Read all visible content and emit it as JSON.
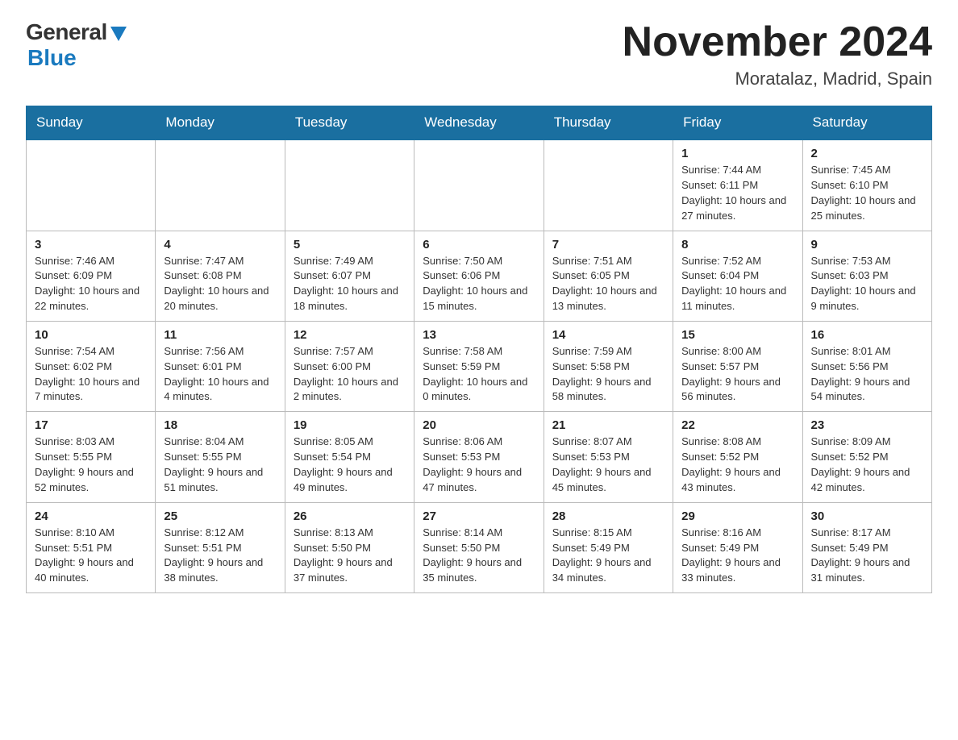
{
  "logo": {
    "general": "General",
    "blue": "Blue"
  },
  "title": "November 2024",
  "location": "Moratalaz, Madrid, Spain",
  "days_of_week": [
    "Sunday",
    "Monday",
    "Tuesday",
    "Wednesday",
    "Thursday",
    "Friday",
    "Saturday"
  ],
  "weeks": [
    [
      {
        "day": "",
        "info": ""
      },
      {
        "day": "",
        "info": ""
      },
      {
        "day": "",
        "info": ""
      },
      {
        "day": "",
        "info": ""
      },
      {
        "day": "",
        "info": ""
      },
      {
        "day": "1",
        "info": "Sunrise: 7:44 AM\nSunset: 6:11 PM\nDaylight: 10 hours and 27 minutes."
      },
      {
        "day": "2",
        "info": "Sunrise: 7:45 AM\nSunset: 6:10 PM\nDaylight: 10 hours and 25 minutes."
      }
    ],
    [
      {
        "day": "3",
        "info": "Sunrise: 7:46 AM\nSunset: 6:09 PM\nDaylight: 10 hours and 22 minutes."
      },
      {
        "day": "4",
        "info": "Sunrise: 7:47 AM\nSunset: 6:08 PM\nDaylight: 10 hours and 20 minutes."
      },
      {
        "day": "5",
        "info": "Sunrise: 7:49 AM\nSunset: 6:07 PM\nDaylight: 10 hours and 18 minutes."
      },
      {
        "day": "6",
        "info": "Sunrise: 7:50 AM\nSunset: 6:06 PM\nDaylight: 10 hours and 15 minutes."
      },
      {
        "day": "7",
        "info": "Sunrise: 7:51 AM\nSunset: 6:05 PM\nDaylight: 10 hours and 13 minutes."
      },
      {
        "day": "8",
        "info": "Sunrise: 7:52 AM\nSunset: 6:04 PM\nDaylight: 10 hours and 11 minutes."
      },
      {
        "day": "9",
        "info": "Sunrise: 7:53 AM\nSunset: 6:03 PM\nDaylight: 10 hours and 9 minutes."
      }
    ],
    [
      {
        "day": "10",
        "info": "Sunrise: 7:54 AM\nSunset: 6:02 PM\nDaylight: 10 hours and 7 minutes."
      },
      {
        "day": "11",
        "info": "Sunrise: 7:56 AM\nSunset: 6:01 PM\nDaylight: 10 hours and 4 minutes."
      },
      {
        "day": "12",
        "info": "Sunrise: 7:57 AM\nSunset: 6:00 PM\nDaylight: 10 hours and 2 minutes."
      },
      {
        "day": "13",
        "info": "Sunrise: 7:58 AM\nSunset: 5:59 PM\nDaylight: 10 hours and 0 minutes."
      },
      {
        "day": "14",
        "info": "Sunrise: 7:59 AM\nSunset: 5:58 PM\nDaylight: 9 hours and 58 minutes."
      },
      {
        "day": "15",
        "info": "Sunrise: 8:00 AM\nSunset: 5:57 PM\nDaylight: 9 hours and 56 minutes."
      },
      {
        "day": "16",
        "info": "Sunrise: 8:01 AM\nSunset: 5:56 PM\nDaylight: 9 hours and 54 minutes."
      }
    ],
    [
      {
        "day": "17",
        "info": "Sunrise: 8:03 AM\nSunset: 5:55 PM\nDaylight: 9 hours and 52 minutes."
      },
      {
        "day": "18",
        "info": "Sunrise: 8:04 AM\nSunset: 5:55 PM\nDaylight: 9 hours and 51 minutes."
      },
      {
        "day": "19",
        "info": "Sunrise: 8:05 AM\nSunset: 5:54 PM\nDaylight: 9 hours and 49 minutes."
      },
      {
        "day": "20",
        "info": "Sunrise: 8:06 AM\nSunset: 5:53 PM\nDaylight: 9 hours and 47 minutes."
      },
      {
        "day": "21",
        "info": "Sunrise: 8:07 AM\nSunset: 5:53 PM\nDaylight: 9 hours and 45 minutes."
      },
      {
        "day": "22",
        "info": "Sunrise: 8:08 AM\nSunset: 5:52 PM\nDaylight: 9 hours and 43 minutes."
      },
      {
        "day": "23",
        "info": "Sunrise: 8:09 AM\nSunset: 5:52 PM\nDaylight: 9 hours and 42 minutes."
      }
    ],
    [
      {
        "day": "24",
        "info": "Sunrise: 8:10 AM\nSunset: 5:51 PM\nDaylight: 9 hours and 40 minutes."
      },
      {
        "day": "25",
        "info": "Sunrise: 8:12 AM\nSunset: 5:51 PM\nDaylight: 9 hours and 38 minutes."
      },
      {
        "day": "26",
        "info": "Sunrise: 8:13 AM\nSunset: 5:50 PM\nDaylight: 9 hours and 37 minutes."
      },
      {
        "day": "27",
        "info": "Sunrise: 8:14 AM\nSunset: 5:50 PM\nDaylight: 9 hours and 35 minutes."
      },
      {
        "day": "28",
        "info": "Sunrise: 8:15 AM\nSunset: 5:49 PM\nDaylight: 9 hours and 34 minutes."
      },
      {
        "day": "29",
        "info": "Sunrise: 8:16 AM\nSunset: 5:49 PM\nDaylight: 9 hours and 33 minutes."
      },
      {
        "day": "30",
        "info": "Sunrise: 8:17 AM\nSunset: 5:49 PM\nDaylight: 9 hours and 31 minutes."
      }
    ]
  ]
}
